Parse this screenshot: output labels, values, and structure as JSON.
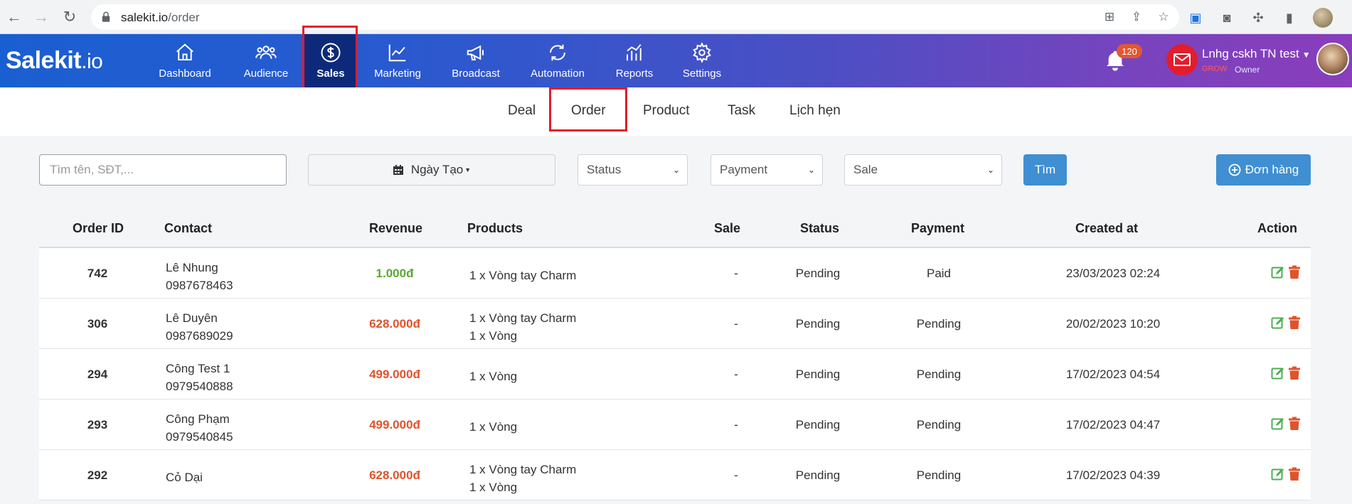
{
  "browser": {
    "url_domain": "salekit.io",
    "url_path": "/order"
  },
  "app": {
    "logo_main": "Salekit",
    "logo_tld": ".io",
    "nav": [
      {
        "label": "Dashboard",
        "icon": "home-icon"
      },
      {
        "label": "Audience",
        "icon": "users-icon"
      },
      {
        "label": "Sales",
        "icon": "dollar-circle-icon",
        "active": true
      },
      {
        "label": "Marketing",
        "icon": "chart-line-icon"
      },
      {
        "label": "Broadcast",
        "icon": "megaphone-icon"
      },
      {
        "label": "Automation",
        "icon": "refresh-icon"
      },
      {
        "label": "Reports",
        "icon": "analytics-icon"
      },
      {
        "label": "Settings",
        "icon": "gear-icon"
      }
    ],
    "notification_count": "120",
    "user": {
      "name": "Lnhg cskh TN test",
      "tier": "GROW",
      "role": "Owner"
    }
  },
  "subtabs": [
    {
      "label": "Deal"
    },
    {
      "label": "Order",
      "active": true
    },
    {
      "label": "Product"
    },
    {
      "label": "Task"
    },
    {
      "label": "Lịch hẹn"
    }
  ],
  "filters": {
    "search_placeholder": "Tìm tên, SĐT,...",
    "date_label": "Ngày Tạo",
    "status_label": "Status",
    "payment_label": "Payment",
    "sale_label": "Sale",
    "search_button": "Tìm",
    "new_order_button": "Đơn hàng"
  },
  "table": {
    "columns": [
      "Order ID",
      "Contact",
      "Revenue",
      "Products",
      "Sale",
      "Status",
      "Payment",
      "Created at",
      "Action"
    ],
    "rows": [
      {
        "id": "742",
        "name": "Lê Nhung",
        "phone": "0987678463",
        "revenue": "1.000đ",
        "revenue_color": "#5aa832",
        "products": [
          "1 x Vòng tay Charm"
        ],
        "sale": "-",
        "status": "Pending",
        "payment": "Paid",
        "created": "23/03/2023 02:24"
      },
      {
        "id": "306",
        "name": "Lê Duyên",
        "phone": "0987689029",
        "revenue": "628.000đ",
        "revenue_color": "#e0532c",
        "products": [
          "1 x Vòng tay Charm",
          "1 x Vòng"
        ],
        "sale": "-",
        "status": "Pending",
        "payment": "Pending",
        "created": "20/02/2023 10:20"
      },
      {
        "id": "294",
        "name": "Công Test 1",
        "phone": "0979540888",
        "revenue": "499.000đ",
        "revenue_color": "#e0532c",
        "products": [
          "1 x Vòng"
        ],
        "sale": "-",
        "status": "Pending",
        "payment": "Pending",
        "created": "17/02/2023 04:54"
      },
      {
        "id": "293",
        "name": "Công Phạm",
        "phone": "0979540845",
        "revenue": "499.000đ",
        "revenue_color": "#e0532c",
        "products": [
          "1 x Vòng"
        ],
        "sale": "-",
        "status": "Pending",
        "payment": "Pending",
        "created": "17/02/2023 04:47"
      },
      {
        "id": "292",
        "name": "Cỏ Dại",
        "phone": "",
        "revenue": "628.000đ",
        "revenue_color": "#e0532c",
        "products": [
          "1 x Vòng tay Charm",
          "1 x Vòng"
        ],
        "sale": "-",
        "status": "Pending",
        "payment": "Pending",
        "created": "17/02/2023 04:39"
      }
    ]
  },
  "colors": {
    "accent": "#3f8fd2",
    "highlight": "#e41c2b",
    "edit": "#4caf50",
    "delete": "#e0532c"
  }
}
